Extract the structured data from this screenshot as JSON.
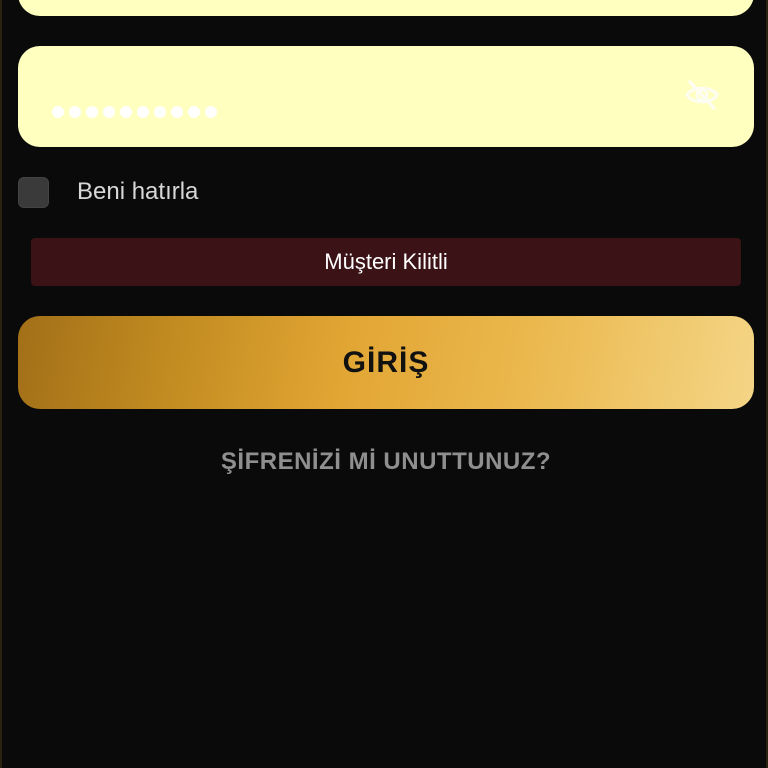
{
  "login_form": {
    "password_dot_count": 10,
    "remember_me_label": "Beni hatırla",
    "remember_me_checked": false,
    "alert_message": "Müşteri Kilitli",
    "login_button_label": "GİRİŞ",
    "forgot_password_label": "ŞİFRENİZİ Mİ UNUTTUNUZ?",
    "visibility_toggle_icon": "eye-off-icon"
  },
  "colors": {
    "background": "#0a0a0a",
    "input_fill": "#ffffbf",
    "alert_fill": "#3b1216",
    "button_gradient_start": "#a26f18",
    "button_gradient_end": "#f4d586",
    "link_text": "#8f8f8f"
  }
}
